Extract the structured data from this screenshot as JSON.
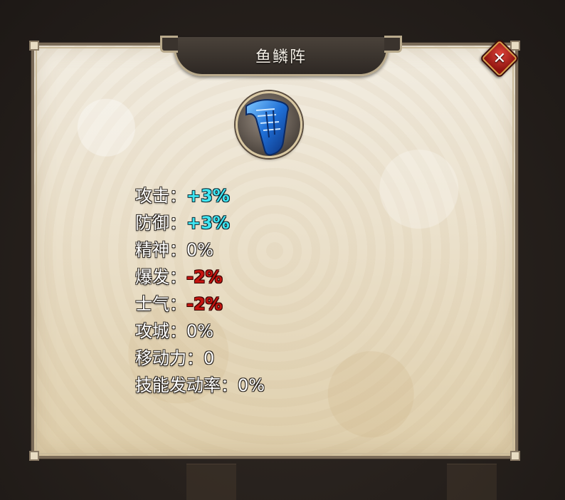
{
  "dialog": {
    "title": "鱼鳞阵",
    "close_icon": "close-icon",
    "emblem_icon": "formation-scroll-icon",
    "stats": [
      {
        "label": "攻击：",
        "value": "+3%",
        "tone": "pos"
      },
      {
        "label": "防御：",
        "value": "+3%",
        "tone": "pos"
      },
      {
        "label": "精神：",
        "value": "0%",
        "tone": "neutral"
      },
      {
        "label": "爆发：",
        "value": "-2%",
        "tone": "neg"
      },
      {
        "label": "士气：",
        "value": "-2%",
        "tone": "neg"
      },
      {
        "label": "攻城：",
        "value": "0%",
        "tone": "neutral"
      },
      {
        "label": "移动力：",
        "value": "0",
        "tone": "neutral"
      },
      {
        "label": "技能发动率：",
        "value": "0%",
        "tone": "neutral"
      }
    ]
  },
  "colors": {
    "positive": "#3fe6f2",
    "negative": "#c41410",
    "neutral": "#ffffff"
  }
}
